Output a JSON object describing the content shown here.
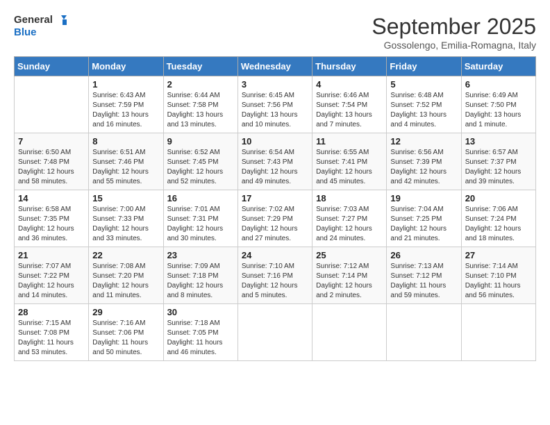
{
  "header": {
    "logo_line1": "General",
    "logo_line2": "Blue",
    "month": "September 2025",
    "location": "Gossolengo, Emilia-Romagna, Italy"
  },
  "days_of_week": [
    "Sunday",
    "Monday",
    "Tuesday",
    "Wednesday",
    "Thursday",
    "Friday",
    "Saturday"
  ],
  "weeks": [
    [
      {
        "day": "",
        "info": ""
      },
      {
        "day": "1",
        "info": "Sunrise: 6:43 AM\nSunset: 7:59 PM\nDaylight: 13 hours\nand 16 minutes."
      },
      {
        "day": "2",
        "info": "Sunrise: 6:44 AM\nSunset: 7:58 PM\nDaylight: 13 hours\nand 13 minutes."
      },
      {
        "day": "3",
        "info": "Sunrise: 6:45 AM\nSunset: 7:56 PM\nDaylight: 13 hours\nand 10 minutes."
      },
      {
        "day": "4",
        "info": "Sunrise: 6:46 AM\nSunset: 7:54 PM\nDaylight: 13 hours\nand 7 minutes."
      },
      {
        "day": "5",
        "info": "Sunrise: 6:48 AM\nSunset: 7:52 PM\nDaylight: 13 hours\nand 4 minutes."
      },
      {
        "day": "6",
        "info": "Sunrise: 6:49 AM\nSunset: 7:50 PM\nDaylight: 13 hours\nand 1 minute."
      }
    ],
    [
      {
        "day": "7",
        "info": "Sunrise: 6:50 AM\nSunset: 7:48 PM\nDaylight: 12 hours\nand 58 minutes."
      },
      {
        "day": "8",
        "info": "Sunrise: 6:51 AM\nSunset: 7:46 PM\nDaylight: 12 hours\nand 55 minutes."
      },
      {
        "day": "9",
        "info": "Sunrise: 6:52 AM\nSunset: 7:45 PM\nDaylight: 12 hours\nand 52 minutes."
      },
      {
        "day": "10",
        "info": "Sunrise: 6:54 AM\nSunset: 7:43 PM\nDaylight: 12 hours\nand 49 minutes."
      },
      {
        "day": "11",
        "info": "Sunrise: 6:55 AM\nSunset: 7:41 PM\nDaylight: 12 hours\nand 45 minutes."
      },
      {
        "day": "12",
        "info": "Sunrise: 6:56 AM\nSunset: 7:39 PM\nDaylight: 12 hours\nand 42 minutes."
      },
      {
        "day": "13",
        "info": "Sunrise: 6:57 AM\nSunset: 7:37 PM\nDaylight: 12 hours\nand 39 minutes."
      }
    ],
    [
      {
        "day": "14",
        "info": "Sunrise: 6:58 AM\nSunset: 7:35 PM\nDaylight: 12 hours\nand 36 minutes."
      },
      {
        "day": "15",
        "info": "Sunrise: 7:00 AM\nSunset: 7:33 PM\nDaylight: 12 hours\nand 33 minutes."
      },
      {
        "day": "16",
        "info": "Sunrise: 7:01 AM\nSunset: 7:31 PM\nDaylight: 12 hours\nand 30 minutes."
      },
      {
        "day": "17",
        "info": "Sunrise: 7:02 AM\nSunset: 7:29 PM\nDaylight: 12 hours\nand 27 minutes."
      },
      {
        "day": "18",
        "info": "Sunrise: 7:03 AM\nSunset: 7:27 PM\nDaylight: 12 hours\nand 24 minutes."
      },
      {
        "day": "19",
        "info": "Sunrise: 7:04 AM\nSunset: 7:25 PM\nDaylight: 12 hours\nand 21 minutes."
      },
      {
        "day": "20",
        "info": "Sunrise: 7:06 AM\nSunset: 7:24 PM\nDaylight: 12 hours\nand 18 minutes."
      }
    ],
    [
      {
        "day": "21",
        "info": "Sunrise: 7:07 AM\nSunset: 7:22 PM\nDaylight: 12 hours\nand 14 minutes."
      },
      {
        "day": "22",
        "info": "Sunrise: 7:08 AM\nSunset: 7:20 PM\nDaylight: 12 hours\nand 11 minutes."
      },
      {
        "day": "23",
        "info": "Sunrise: 7:09 AM\nSunset: 7:18 PM\nDaylight: 12 hours\nand 8 minutes."
      },
      {
        "day": "24",
        "info": "Sunrise: 7:10 AM\nSunset: 7:16 PM\nDaylight: 12 hours\nand 5 minutes."
      },
      {
        "day": "25",
        "info": "Sunrise: 7:12 AM\nSunset: 7:14 PM\nDaylight: 12 hours\nand 2 minutes."
      },
      {
        "day": "26",
        "info": "Sunrise: 7:13 AM\nSunset: 7:12 PM\nDaylight: 11 hours\nand 59 minutes."
      },
      {
        "day": "27",
        "info": "Sunrise: 7:14 AM\nSunset: 7:10 PM\nDaylight: 11 hours\nand 56 minutes."
      }
    ],
    [
      {
        "day": "28",
        "info": "Sunrise: 7:15 AM\nSunset: 7:08 PM\nDaylight: 11 hours\nand 53 minutes."
      },
      {
        "day": "29",
        "info": "Sunrise: 7:16 AM\nSunset: 7:06 PM\nDaylight: 11 hours\nand 50 minutes."
      },
      {
        "day": "30",
        "info": "Sunrise: 7:18 AM\nSunset: 7:05 PM\nDaylight: 11 hours\nand 46 minutes."
      },
      {
        "day": "",
        "info": ""
      },
      {
        "day": "",
        "info": ""
      },
      {
        "day": "",
        "info": ""
      },
      {
        "day": "",
        "info": ""
      }
    ]
  ]
}
